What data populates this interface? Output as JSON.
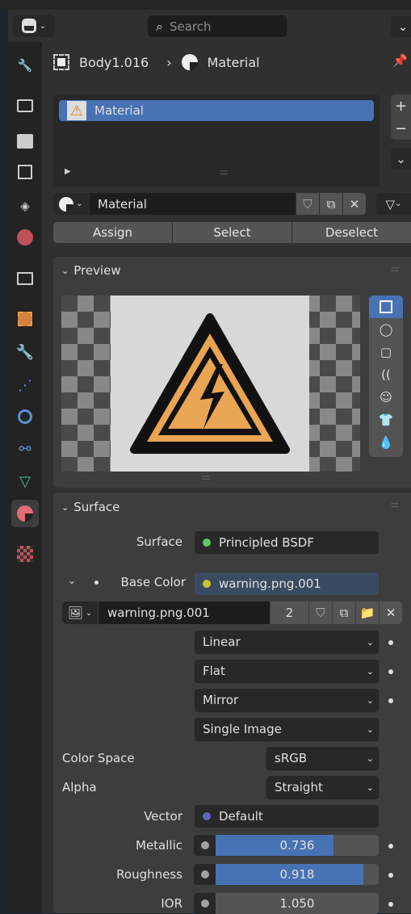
{
  "header": {
    "search_placeholder": "Search"
  },
  "breadcrumb": {
    "object": "Body1.016",
    "material": "Material"
  },
  "material_slots": [
    {
      "name": "Material",
      "selected": true
    }
  ],
  "material_selector": {
    "name": "Material"
  },
  "slot_buttons": {
    "assign": "Assign",
    "select": "Select",
    "deselect": "Deselect"
  },
  "preview": {
    "title": "Preview",
    "shapes": [
      "plane",
      "sphere",
      "cube",
      "hair",
      "monkey",
      "cloth",
      "fluid"
    ],
    "selected_shape": "plane"
  },
  "surface": {
    "title": "Surface",
    "surface_label": "Surface",
    "surface_value": "Principled BSDF",
    "base_color_label": "Base Color",
    "base_color_value": "warning.png.001",
    "image_name": "warning.png.001",
    "image_users": "2",
    "interpolation": "Linear",
    "projection": "Flat",
    "extension": "Mirror",
    "source": "Single Image",
    "color_space_label": "Color Space",
    "color_space": "sRGB",
    "alpha_label": "Alpha",
    "alpha": "Straight",
    "vector_label": "Vector",
    "vector_value": "Default",
    "metallic_label": "Metallic",
    "metallic": "0.736",
    "roughness_label": "Roughness",
    "roughness": "0.918",
    "ior_label": "IOR",
    "ior": "1.050"
  },
  "colors": {
    "accent": "#4772b3",
    "shader_socket": "#63c763",
    "color_socket": "#c7c729",
    "vector_socket": "#6363c7",
    "material_tab": "#e06d75"
  }
}
